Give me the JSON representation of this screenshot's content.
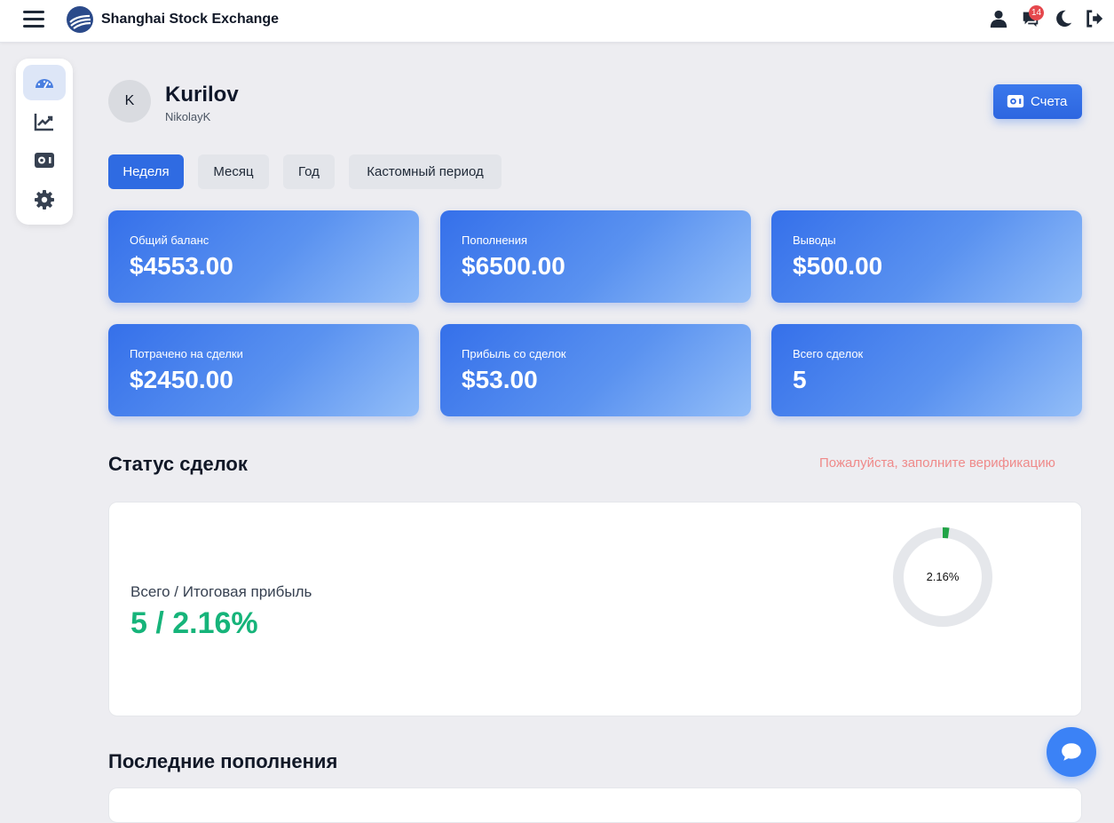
{
  "header": {
    "brand": "Shanghai Stock Exchange",
    "notification_count": "14"
  },
  "user": {
    "avatar_letter": "K",
    "name": "Kurilov",
    "login": "NikolayK",
    "accounts_label": "Счета"
  },
  "periods": [
    "Неделя",
    "Месяц",
    "Год",
    "Кастомный период"
  ],
  "active_period": "Неделя",
  "stats": [
    {
      "label": "Общий баланс",
      "value": "$4553.00"
    },
    {
      "label": "Пополнения",
      "value": "$6500.00"
    },
    {
      "label": "Выводы",
      "value": "$500.00"
    },
    {
      "label": "Потрачено на сделки",
      "value": "$2450.00"
    },
    {
      "label": "Прибыль со сделок",
      "value": "$53.00"
    },
    {
      "label": "Всего сделок",
      "value": "5"
    }
  ],
  "trade_status": {
    "title": "Статус сделок",
    "verify_link": "Пожалуйста, заполните верификацию",
    "summary_label": "Всего / Итоговая прибыль",
    "summary_value": "5 / 2.16%",
    "donut_label": "2.16%",
    "donut_fraction": 0.0216
  },
  "recent_deposits_title": "Последние пополнения",
  "colors": {
    "accent": "#2f6be2",
    "profit_green": "#16b47a",
    "warning_red": "#ef8a8a",
    "donut_fill": "#22a447",
    "donut_track": "#e5e7eb"
  },
  "icons": {
    "sidebar": [
      "dashboard-icon",
      "chart-line-icon",
      "wallet-icon",
      "gear-icon"
    ],
    "topbar": [
      "user-icon",
      "messages-icon",
      "moon-icon",
      "logout-icon"
    ]
  }
}
